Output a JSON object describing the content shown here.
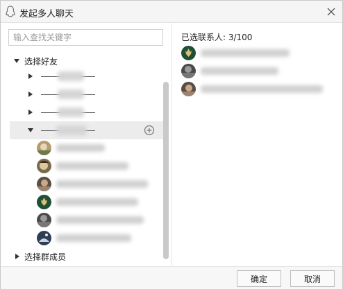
{
  "window": {
    "title": "发起多人聊天"
  },
  "search": {
    "placeholder": "输入查找关键字"
  },
  "tree": {
    "friends_label": "选择好友",
    "groups_label": "选择群成员"
  },
  "selected": {
    "count_text": "已选联系人: 3/100"
  },
  "buttons": {
    "ok": "确定",
    "cancel": "取消"
  },
  "colors": {
    "titlebar": "#f5f5f5",
    "selected_row": "#ececec",
    "scrollbar": "#c9c9c9"
  },
  "icons": {
    "app": "penguin-icon",
    "close": "close-icon",
    "add": "add-circle-icon"
  }
}
